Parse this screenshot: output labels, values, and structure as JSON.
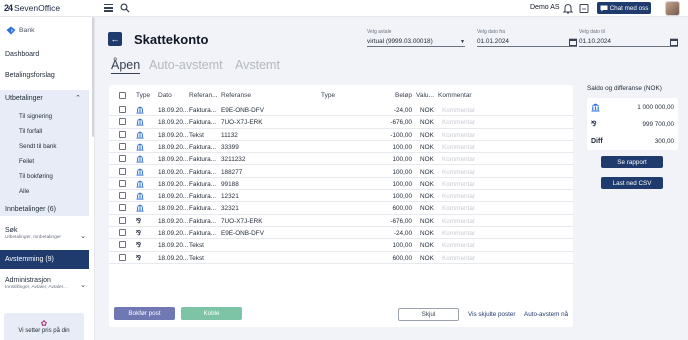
{
  "topbar": {
    "logo_mark": "24",
    "logo_text": "SevenOffice",
    "company": "Demo AS",
    "chat_label": "Chat med oss"
  },
  "sidebar": {
    "bank_label": "Bank",
    "dashboard": "Dashboard",
    "betalingsforslag": "Betalingsforslag",
    "utbetalinger": "Utbetalinger",
    "utbetalinger_items": [
      "Til signering",
      "Til forfall",
      "Sendt til bank",
      "Feilet",
      "Til bokføring",
      "Alle"
    ],
    "innbetalinger": "Innbetalinger (6)",
    "sok": "Søk",
    "sok_sub": "Utbetalinger, Innbetalinger",
    "avstemming": "Avstemming (9)",
    "administrasjon": "Administrasjon",
    "administrasjon_sub": "Innstillinger, Avtaler, Avtaler...",
    "promo_text": "Vi setter pris på din"
  },
  "header": {
    "title": "Skattekonto",
    "avtale_label": "Velg avtale",
    "avtale_value": "virtual (9999.03.00018)",
    "dato_fra_label": "Velg dato fra",
    "dato_fra_value": "01.01.2024",
    "dato_til_label": "Velg dato til",
    "dato_til_value": "01.10.2024"
  },
  "tabs": [
    "Åpen",
    "Auto-avstemt",
    "Avstemt"
  ],
  "table": {
    "columns": [
      "Type",
      "Dato",
      "Referan...",
      "Referanse",
      "Type",
      "Beløp",
      "Valu...",
      "Kommentar"
    ],
    "comment_placeholder": "Kommentar",
    "rows": [
      {
        "icon": "bank",
        "dato": "18.09.20...",
        "ref1": "Faktura...",
        "ref2": "E9E-ONB-DFV",
        "belop": "-24,00",
        "valuta": "NOK"
      },
      {
        "icon": "bank",
        "dato": "18.09.20...",
        "ref1": "Faktura...",
        "ref2": "7UO-X7J-ERK",
        "belop": "-676,00",
        "valuta": "NOK"
      },
      {
        "icon": "bank",
        "dato": "18.09.20...",
        "ref1": "Tekst",
        "ref2": "11132",
        "belop": "-100,00",
        "valuta": "NOK"
      },
      {
        "icon": "bank",
        "dato": "18.09.20...",
        "ref1": "Faktura...",
        "ref2": "33399",
        "belop": "100,00",
        "valuta": "NOK"
      },
      {
        "icon": "bank",
        "dato": "18.09.20...",
        "ref1": "Faktura...",
        "ref2": "3211232",
        "belop": "100,00",
        "valuta": "NOK"
      },
      {
        "icon": "bank",
        "dato": "18.09.20...",
        "ref1": "Faktura...",
        "ref2": "188277",
        "belop": "100,00",
        "valuta": "NOK"
      },
      {
        "icon": "bank",
        "dato": "18.09.20...",
        "ref1": "Faktura...",
        "ref2": "99188",
        "belop": "100,00",
        "valuta": "NOK"
      },
      {
        "icon": "bank",
        "dato": "18.09.20...",
        "ref1": "Faktura...",
        "ref2": "12321",
        "belop": "100,00",
        "valuta": "NOK"
      },
      {
        "icon": "bank",
        "dato": "18.09.20...",
        "ref1": "Faktura...",
        "ref2": "32321",
        "belop": "600,00",
        "valuta": "NOK"
      },
      {
        "icon": "24so",
        "dato": "18.09.20...",
        "ref1": "Faktura...",
        "ref2": "7UO-X7J-ERK",
        "belop": "-676,00",
        "valuta": "NOK"
      },
      {
        "icon": "24so",
        "dato": "18.09.20...",
        "ref1": "Faktura...",
        "ref2": "E9E-ONB-DFV",
        "belop": "-24,00",
        "valuta": "NOK"
      },
      {
        "icon": "24so",
        "dato": "18.09.20...",
        "ref1": "Tekst",
        "ref2": "",
        "belop": "100,00",
        "valuta": "NOK"
      },
      {
        "icon": "24so",
        "dato": "18.09.20...",
        "ref1": "Tekst",
        "ref2": "",
        "belop": "600,00",
        "valuta": "NOK"
      }
    ]
  },
  "actions": {
    "bokfor": "Bokfør post",
    "koble": "Koble",
    "skjul": "Skjul",
    "vis_skjulte": "Vis skjulte poster",
    "auto_avstem": "Auto-avstem nå"
  },
  "summary": {
    "title": "Saldo og differanse (NOK)",
    "bank_value": "1 000 000,00",
    "so_value": "999 700,00",
    "diff_label": "Diff",
    "diff_value": "300,00",
    "rapport_label": "Se rapport",
    "csv_label": "Last ned CSV"
  },
  "colors": {
    "primary": "#1f3b6e",
    "bokfor_button": "#6f78b3",
    "koble_button": "#7dc3a6",
    "sidebar_group": "#e8ecf6"
  }
}
